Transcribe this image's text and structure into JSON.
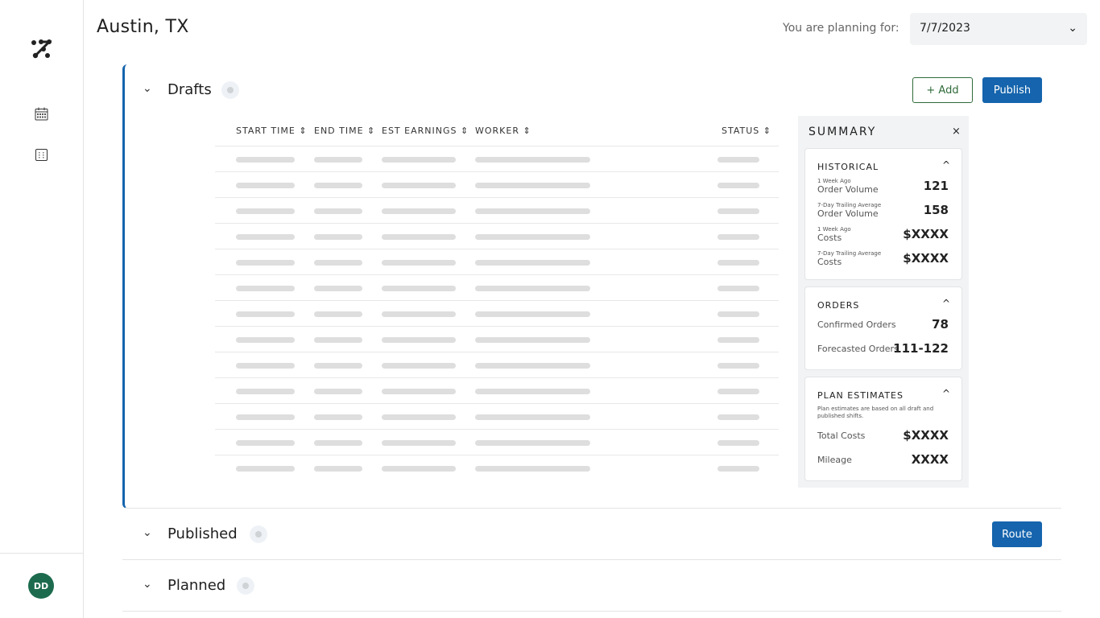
{
  "header": {
    "title": "Austin, TX",
    "planning_label": "You are planning for:",
    "date": "7/7/2023"
  },
  "sidebar": {
    "items": [
      {
        "icon": "calendar-icon"
      },
      {
        "icon": "grid-calendar-icon"
      }
    ],
    "avatar": "DD"
  },
  "drafts": {
    "title": "Drafts",
    "add": "+ Add",
    "publish": "Publish",
    "columns": [
      "START TIME",
      "END TIME",
      "EST EARNINGS",
      "WORKER",
      "STATUS"
    ],
    "row_count": 13
  },
  "summary": {
    "title": "SUMMARY",
    "close": "×",
    "historical": {
      "title": "HISTORICAL",
      "items": [
        {
          "sub": "1 Week Ago",
          "label": "Order Volume",
          "value": "121"
        },
        {
          "sub": "7-Day Trailing Average",
          "label": "Order Volume",
          "value": "158"
        },
        {
          "sub": "1 Week Ago",
          "label": "Costs",
          "value": "$XXXX"
        },
        {
          "sub": "7-Day Trailing Average",
          "label": "Costs",
          "value": "$XXXX"
        }
      ]
    },
    "orders": {
      "title": "ORDERS",
      "items": [
        {
          "label": "Confirmed Orders",
          "value": "78"
        },
        {
          "label": "Forecasted Orders",
          "value": "111-122"
        }
      ]
    },
    "plan": {
      "title": "PLAN ESTIMATES",
      "note": "Plan estimates are based on all draft and published shifts.",
      "items": [
        {
          "label": "Total Costs",
          "value": "$XXXX"
        },
        {
          "label": "Mileage",
          "value": "XXXX"
        }
      ]
    }
  },
  "published": {
    "title": "Published",
    "route": "Route"
  },
  "planned": {
    "title": "Planned"
  }
}
